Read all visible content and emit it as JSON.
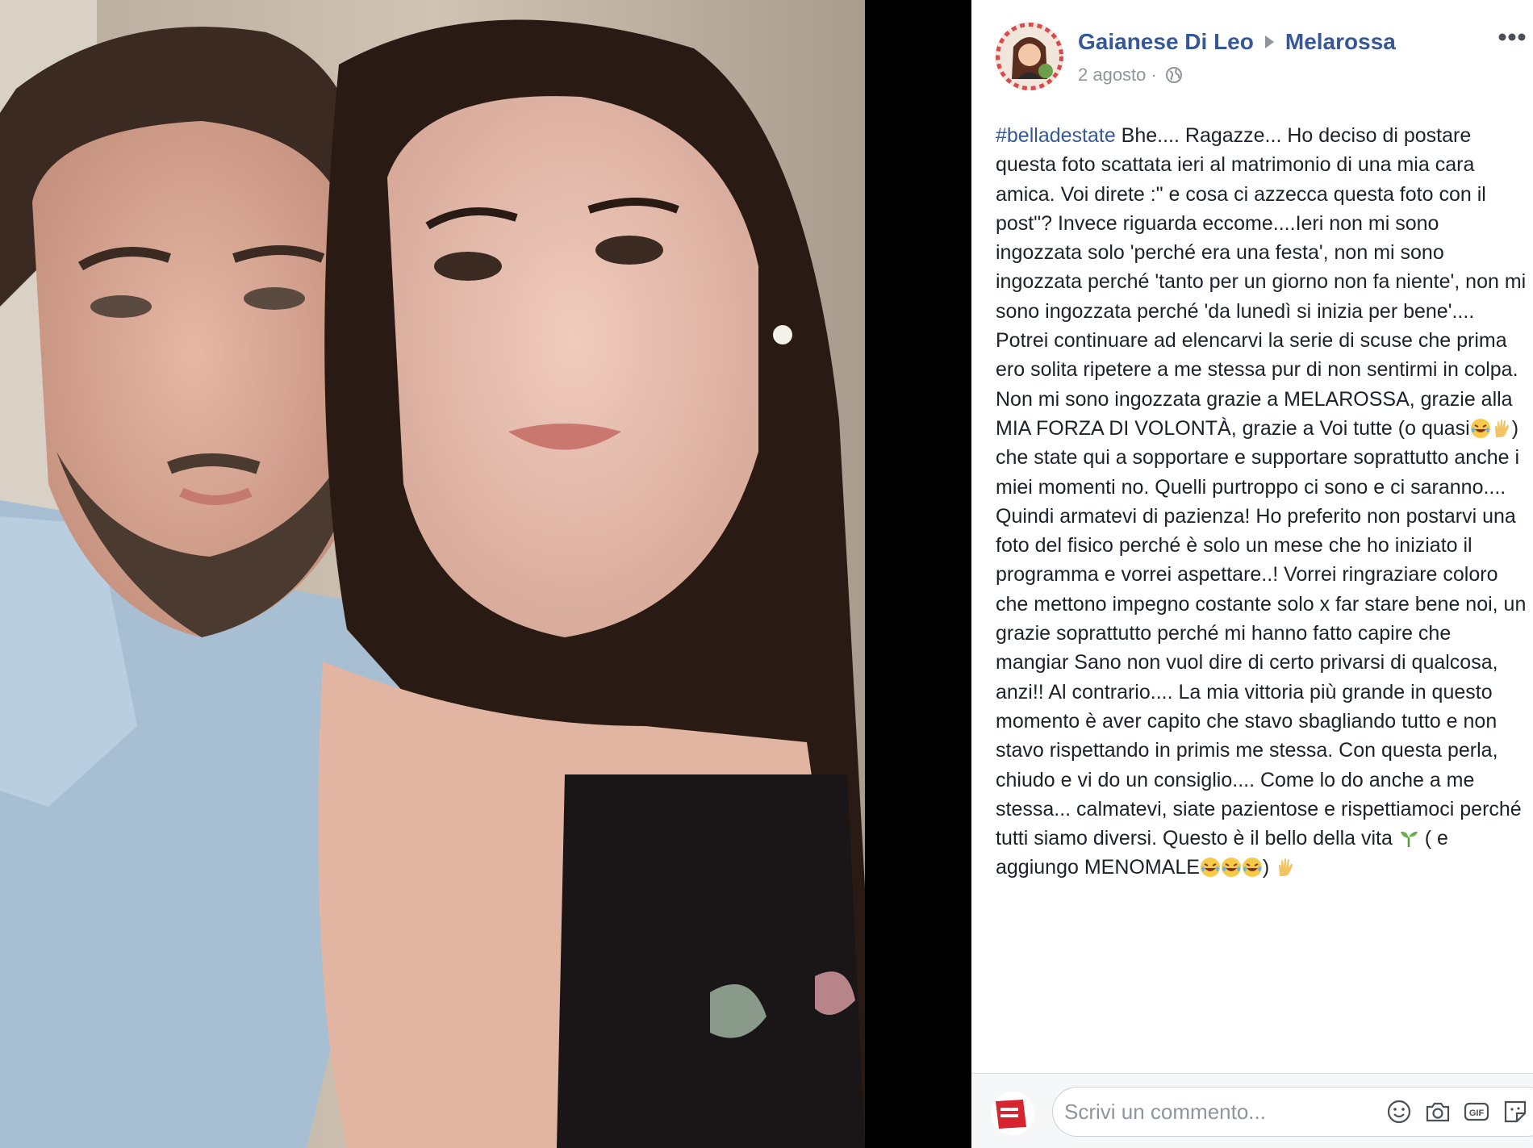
{
  "post": {
    "author": "Gaianese Di Leo",
    "group": "Melarossa",
    "date": "2 agosto",
    "date_sep": "·",
    "hashtag": "#belladestate",
    "text_1": " Bhe.... Ragazze... Ho deciso di postare questa foto scattata ieri al matrimonio di una mia cara amica. Voi direte :\" e cosa ci azzecca questa foto con il post\"? Invece riguarda eccome....Ieri non mi sono ingozzata solo 'perché era una festa', non mi sono ingozzata perché 'tanto per un giorno non fa niente', non mi sono ingozzata perché 'da lunedì si inizia per bene'.... Potrei continuare ad elencarvi la serie di scuse che prima ero solita ripetere a me stessa pur di non sentirmi in colpa. Non mi sono ingozzata grazie a MELAROSSA, grazie alla MIA FORZA DI VOLONTÀ, grazie a Voi tutte (o quasi",
    "text_2": ") che state qui a sopportare e supportare soprattutto anche i miei momenti no. Quelli purtroppo ci sono e ci saranno.... Quindi armatevi di pazienza! Ho preferito non postarvi una foto del fisico perché è solo un mese che ho iniziato il programma e vorrei aspettare..! Vorrei ringraziare coloro che mettono impegno costante solo x far stare bene noi, un grazie soprattutto perché mi hanno fatto capire che mangiar Sano non vuol dire di certo privarsi di qualcosa, anzi!! Al contrario.... La mia vittoria più grande in questo momento è aver capito che stavo sbagliando tutto e non stavo rispettando in primis me stessa. Con questa perla, chiudo e vi do un consiglio.... Come lo do anche a me stessa... calmatevi, siate pazientose e rispettiamoci perché tutti siamo diversi. Questo è il bello della vita ",
    "text_3": " ( e aggiungo MENOMALE",
    "text_4": ") "
  },
  "comment": {
    "placeholder": "Scrivi un commento..."
  },
  "icons": {
    "more": "more-options-icon",
    "globe": "globe-icon",
    "emoji": "emoji-icon",
    "camera": "camera-icon",
    "gif": "gif-icon",
    "sticker": "sticker-icon"
  },
  "colors": {
    "link": "#365899",
    "text": "#1d2129",
    "muted": "#90949c",
    "panel_bg": "#ffffff",
    "viewer_bg": "#000000"
  }
}
